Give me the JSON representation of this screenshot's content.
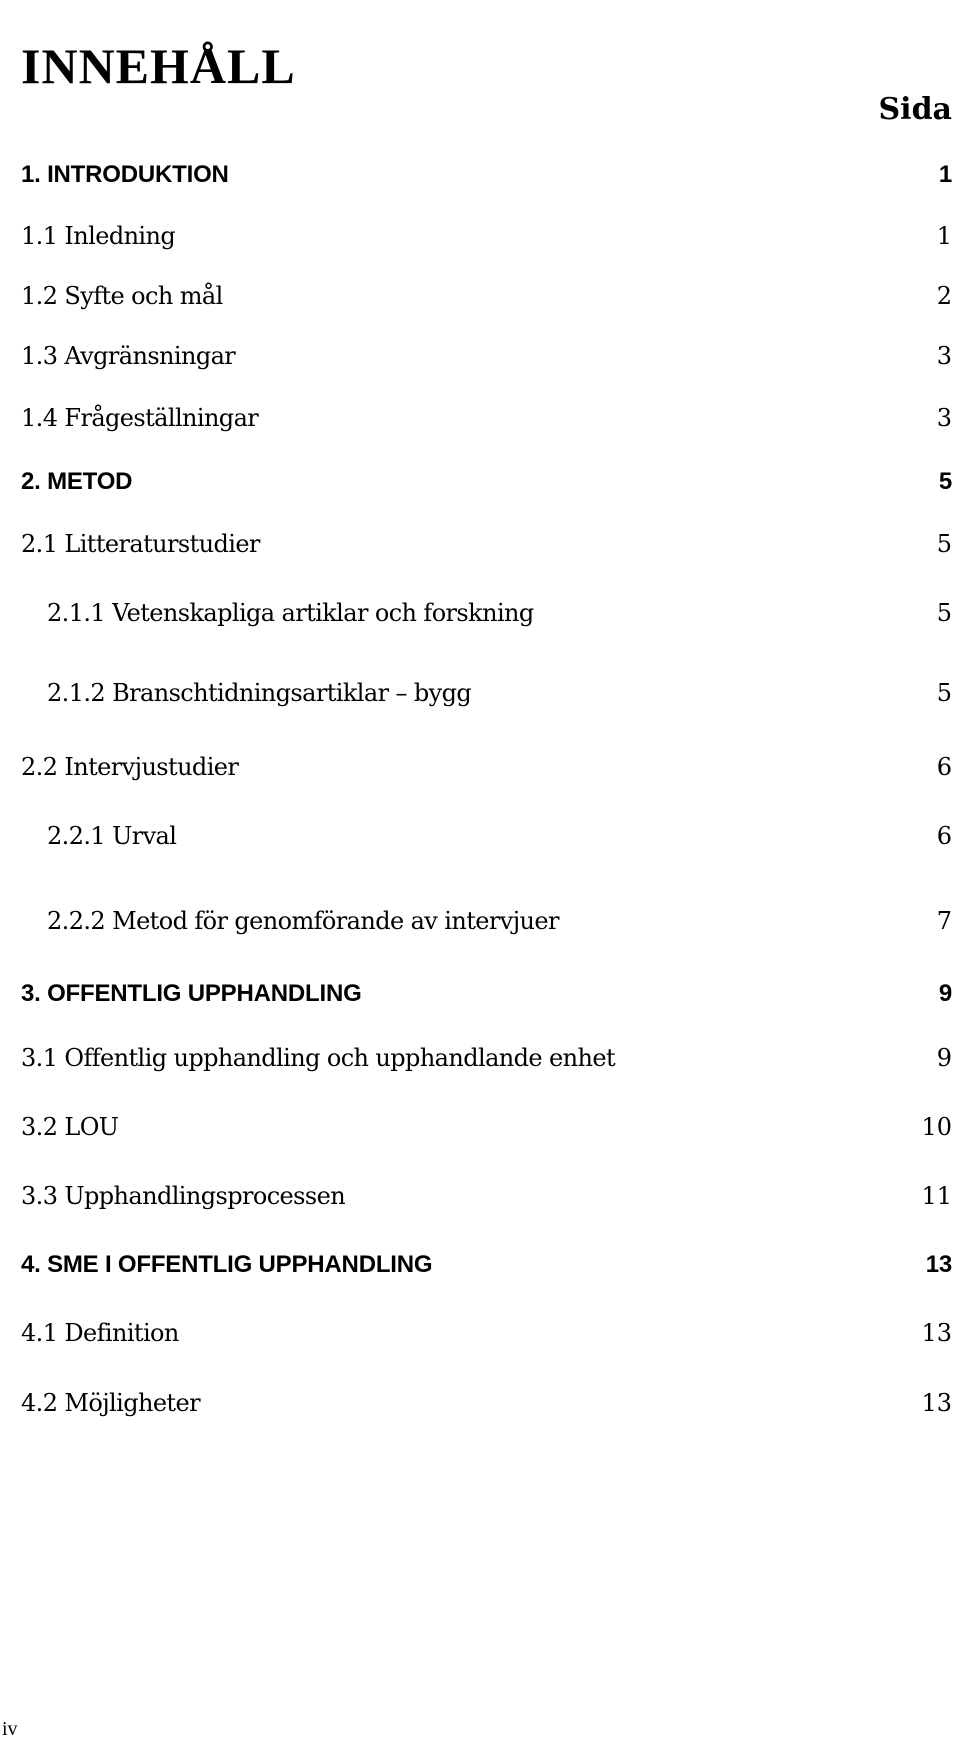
{
  "document": {
    "title": "INNEHÅLL",
    "page_column_header": "Sida",
    "footer_page_number": "iv"
  },
  "toc": {
    "entries": [
      {
        "label": "1. INTRODUKTION",
        "page": "1",
        "level": "chapter"
      },
      {
        "label": "1.1 Inledning",
        "page": "1",
        "level": "section"
      },
      {
        "label": "1.2 Syfte och mål",
        "page": "2",
        "level": "section"
      },
      {
        "label": "1.3 Avgränsningar",
        "page": "3",
        "level": "section"
      },
      {
        "label": "1.4 Frågeställningar",
        "page": "3",
        "level": "section"
      },
      {
        "label": "2. METOD",
        "page": "5",
        "level": "chapter"
      },
      {
        "label": "2.1 Litteraturstudier",
        "page": "5",
        "level": "section"
      },
      {
        "label": "2.1.1 Vetenskapliga artiklar och forskning",
        "page": "5",
        "level": "subsection"
      },
      {
        "label": "2.1.2 Branschtidningsartiklar – bygg",
        "page": "5",
        "level": "subsection"
      },
      {
        "label": "2.2 Intervjustudier",
        "page": "6",
        "level": "section"
      },
      {
        "label": "2.2.1 Urval",
        "page": "6",
        "level": "subsection"
      },
      {
        "label": "2.2.2 Metod för genomförande av intervjuer",
        "page": "7",
        "level": "subsection"
      },
      {
        "label": "3. OFFENTLIG UPPHANDLING",
        "page": "9",
        "level": "chapter"
      },
      {
        "label": "3.1 Offentlig upphandling och upphandlande enhet",
        "page": "9",
        "level": "section"
      },
      {
        "label": "3.2 LOU",
        "page": "10",
        "level": "section"
      },
      {
        "label": "3.3 Upphandlingsprocessen",
        "page": "11",
        "level": "section"
      },
      {
        "label": "4. SME I OFFENTLIG UPPHANDLING",
        "page": "13",
        "level": "chapter"
      },
      {
        "label": "4.1 Definition",
        "page": "13",
        "level": "section"
      },
      {
        "label": "4.2 Möjligheter",
        "page": "13",
        "level": "section"
      }
    ]
  }
}
